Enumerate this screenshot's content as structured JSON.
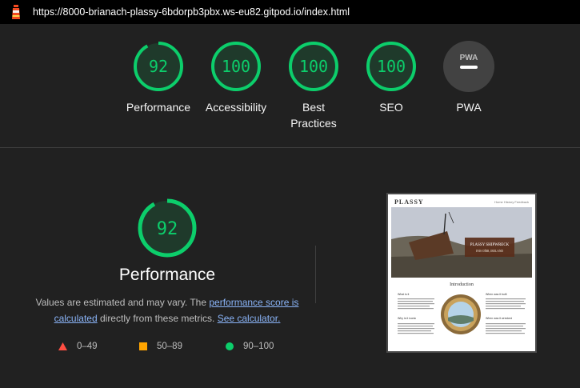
{
  "header": {
    "url": "https://8000-brianach-plassy-6bdorpb3pbx.ws-eu82.gitpod.io/index.html"
  },
  "categories": [
    {
      "score": "92",
      "label": "Performance",
      "fraction": 0.92
    },
    {
      "score": "100",
      "label": "Accessibility",
      "fraction": 1.0
    },
    {
      "score": "100",
      "label": "Best Practices",
      "label_line1": "Best",
      "label_line2": "Practices",
      "fraction": 1.0
    },
    {
      "score": "100",
      "label": "SEO",
      "fraction": 1.0
    },
    {
      "score": "",
      "label": "PWA",
      "badge": "PWA"
    }
  ],
  "performance": {
    "score": "92",
    "fraction": 0.92,
    "title": "Performance",
    "desc_prefix": "Values are estimated and may vary. The ",
    "desc_link1": "performance score is calculated",
    "desc_middle": " directly from these metrics. ",
    "desc_link2": "See calculator."
  },
  "legend": [
    {
      "range": "0–49",
      "shape": "triangle",
      "color": "#ff4e42"
    },
    {
      "range": "50–89",
      "shape": "square",
      "color": "#ffa400"
    },
    {
      "range": "90–100",
      "shape": "circle",
      "color": "#0cce6b"
    }
  ],
  "thumbnail": {
    "brand": "PLASSY",
    "nav": "Home  History  Feedback",
    "hero_caption_line1": "PLASSY SHIPWRECK",
    "hero_caption_line2": "INIS OÍRR, IRELAND",
    "section_title": "Introduction",
    "left_heading1": "What is it",
    "left_heading2": "Why is it iconic",
    "right_heading1": "When was it built",
    "right_heading2": "When was it wrecked"
  },
  "colors": {
    "pass": "#0cce6b",
    "pass_bg": "#1f3a2b",
    "bg": "#212121",
    "link": "#8ab4f8"
  }
}
